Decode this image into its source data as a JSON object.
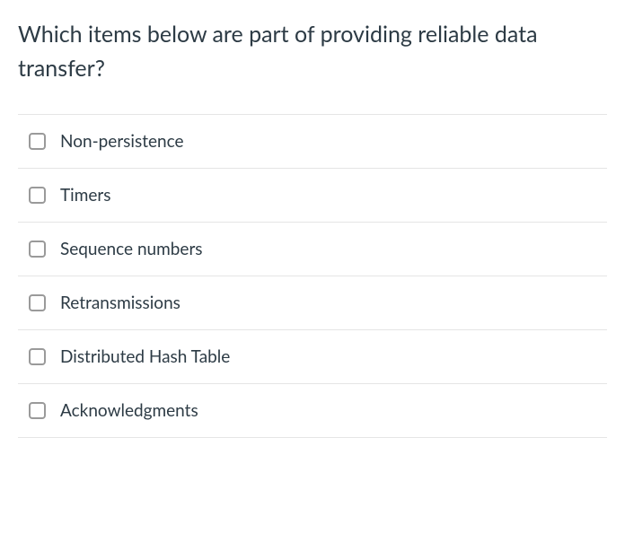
{
  "question": {
    "text": "Which items below are part of providing reliable data transfer?"
  },
  "options": [
    {
      "label": "Non-persistence"
    },
    {
      "label": "Timers"
    },
    {
      "label": "Sequence numbers"
    },
    {
      "label": "Retransmissions"
    },
    {
      "label": "Distributed Hash Table"
    },
    {
      "label": "Acknowledgments"
    }
  ]
}
